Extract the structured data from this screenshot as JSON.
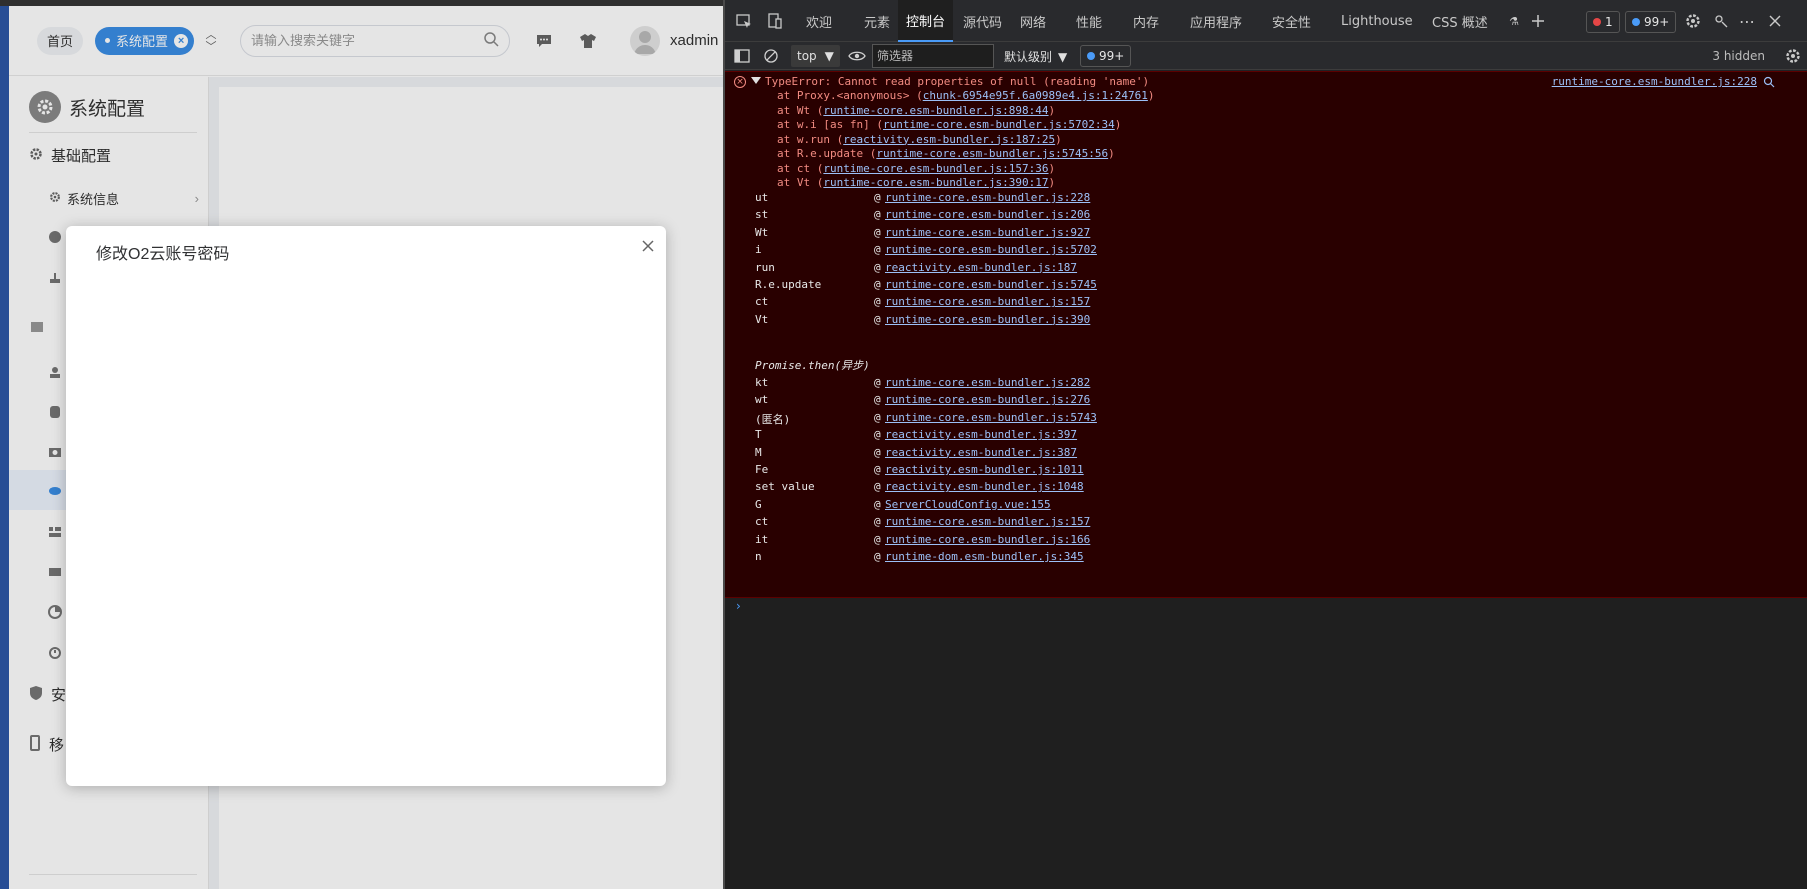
{
  "app": {
    "header": {
      "home_tab": "首页",
      "active_tab": "系统配置",
      "search_placeholder": "请输入搜索关键字",
      "username": "xadmin"
    },
    "sidebar": {
      "title": "系统配置",
      "group_basic": "基础配置",
      "item_system_info": "系统信息",
      "group_security_partial": "安",
      "group_mobile_partial": "移"
    },
    "dialog": {
      "title": "修改O2云账号密码"
    }
  },
  "devtools": {
    "tabs": [
      "欢迎",
      "元素",
      "控制台",
      "源代码",
      "网络",
      "性能",
      "内存",
      "应用程序",
      "安全性",
      "Lighthouse",
      "CSS 概述"
    ],
    "active_tab": "控制台",
    "error_count": "1",
    "message_count": "99+",
    "toolbar": {
      "context": "top",
      "filter_placeholder": "筛选器",
      "levels": "默认级别",
      "issues": "99+",
      "hidden": "3 hidden"
    },
    "error": {
      "message": "TypeError: Cannot read properties of null (reading 'name')",
      "source": "runtime-core.esm-bundler.js:228",
      "trace": [
        {
          "pre": "at Proxy.<anonymous> (",
          "link": "chunk-6954e95f.6a0989e4.js:1:24761",
          "post": ")"
        },
        {
          "pre": "at Wt (",
          "link": "runtime-core.esm-bundler.js:898:44",
          "post": ")"
        },
        {
          "pre": "at w.i [as fn] (",
          "link": "runtime-core.esm-bundler.js:5702:34",
          "post": ")"
        },
        {
          "pre": "at w.run (",
          "link": "reactivity.esm-bundler.js:187:25",
          "post": ")"
        },
        {
          "pre": "at R.e.update (",
          "link": "runtime-core.esm-bundler.js:5745:56",
          "post": ")"
        },
        {
          "pre": "at ct (",
          "link": "runtime-core.esm-bundler.js:157:36",
          "post": ")"
        },
        {
          "pre": "at Vt (",
          "link": "runtime-core.esm-bundler.js:390:17",
          "post": ")"
        }
      ],
      "stack": [
        {
          "fn": "ut",
          "loc": "runtime-core.esm-bundler.js:228"
        },
        {
          "fn": "st",
          "loc": "runtime-core.esm-bundler.js:206"
        },
        {
          "fn": "Wt",
          "loc": "runtime-core.esm-bundler.js:927"
        },
        {
          "fn": "i",
          "loc": "runtime-core.esm-bundler.js:5702"
        },
        {
          "fn": "run",
          "loc": "reactivity.esm-bundler.js:187"
        },
        {
          "fn": "R.e.update",
          "loc": "runtime-core.esm-bundler.js:5745"
        },
        {
          "fn": "ct",
          "loc": "runtime-core.esm-bundler.js:157"
        },
        {
          "fn": "Vt",
          "loc": "runtime-core.esm-bundler.js:390"
        }
      ],
      "async_label": "Promise.then(异步)",
      "stack_async": [
        {
          "fn": "kt",
          "loc": "runtime-core.esm-bundler.js:282"
        },
        {
          "fn": "wt",
          "loc": "runtime-core.esm-bundler.js:276"
        },
        {
          "fn": "(匿名)",
          "loc": "runtime-core.esm-bundler.js:5743"
        },
        {
          "fn": "T",
          "loc": "reactivity.esm-bundler.js:397"
        },
        {
          "fn": "M",
          "loc": "reactivity.esm-bundler.js:387"
        },
        {
          "fn": "Fe",
          "loc": "reactivity.esm-bundler.js:1011"
        },
        {
          "fn": "set value",
          "loc": "reactivity.esm-bundler.js:1048"
        },
        {
          "fn": "G",
          "loc": "ServerCloudConfig.vue:155"
        },
        {
          "fn": "ct",
          "loc": "runtime-core.esm-bundler.js:157"
        },
        {
          "fn": "it",
          "loc": "runtime-core.esm-bundler.js:166"
        },
        {
          "fn": "n",
          "loc": "runtime-dom.esm-bundler.js:345"
        }
      ]
    },
    "prompt": "›"
  },
  "colors": {
    "brand_blue": "#3a8ee6",
    "error_bg": "#290000",
    "error_text": "#f28b82",
    "link": "#9cc0f7"
  }
}
